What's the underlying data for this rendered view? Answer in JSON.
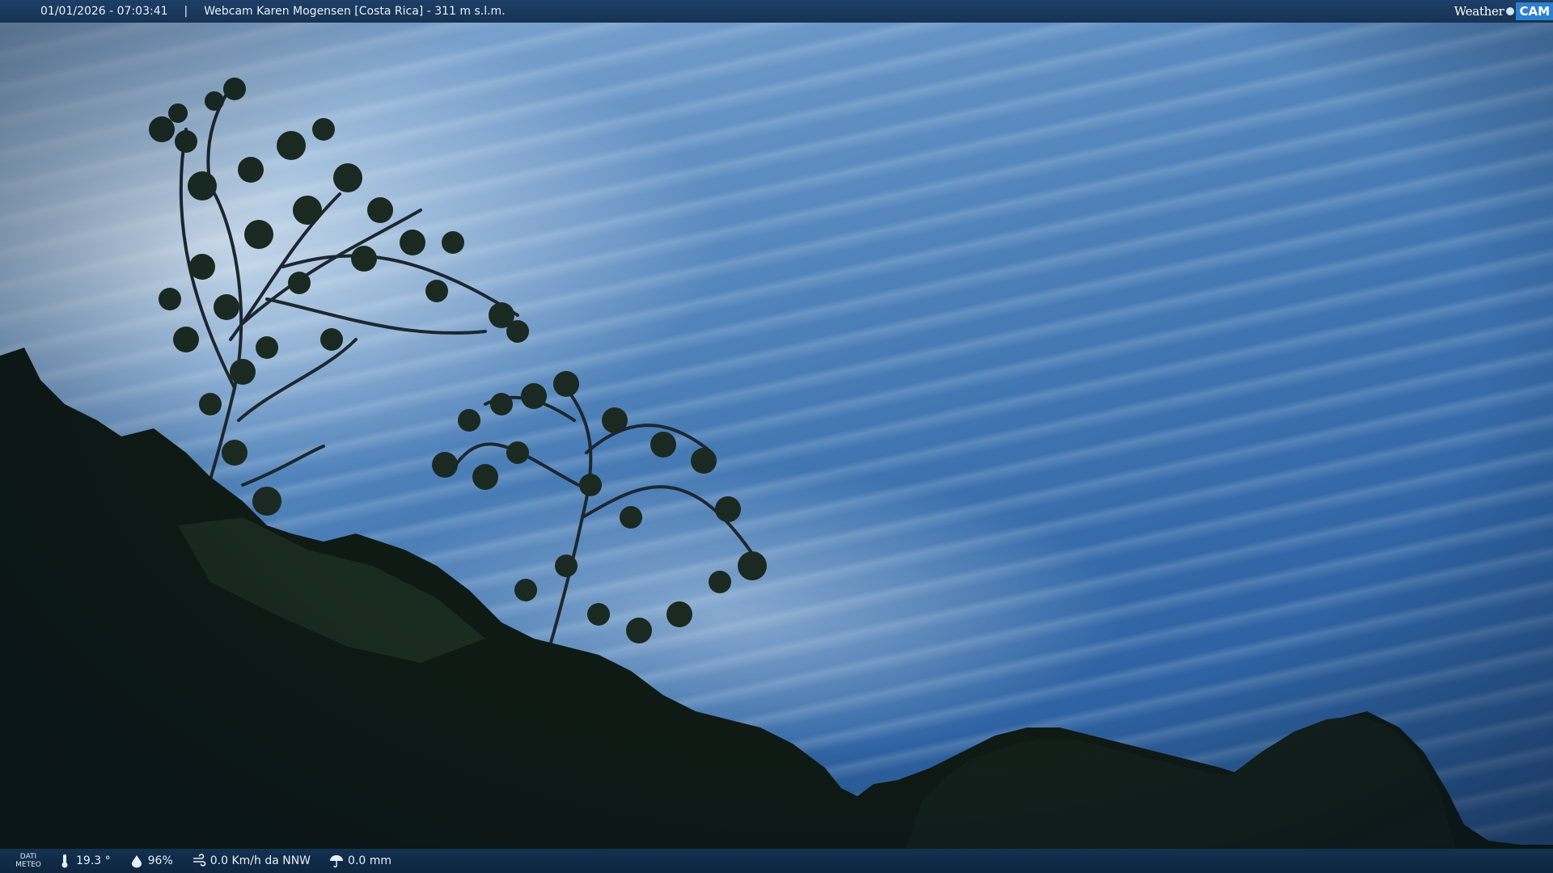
{
  "header": {
    "datetime": "01/01/2026 - 07:03:41",
    "separator": "|",
    "webcam_title": "Webcam Karen Mogensen [Costa Rica]  - 311 m s.l.m."
  },
  "logo": {
    "weather_text": "Weather",
    "cam_text": "CAM"
  },
  "footer": {
    "dati_line1": "DATI",
    "dati_line2": "METEO",
    "temperature": "19.3 °",
    "humidity": "96%",
    "wind": "0.0 Km/h da NNW",
    "rain": "0.0 mm"
  },
  "colors": {
    "bar_bg": "#163354",
    "sky_top": "#8fb1d6",
    "sky_bottom": "#2a5b98",
    "foliage": "#0f1a14",
    "logo_accent": "#2d7fd0"
  },
  "icons": {
    "temperature": "thermometer-icon",
    "humidity": "humidity-drop-icon",
    "wind": "wind-icon",
    "rain": "rain-umbrella-icon"
  }
}
